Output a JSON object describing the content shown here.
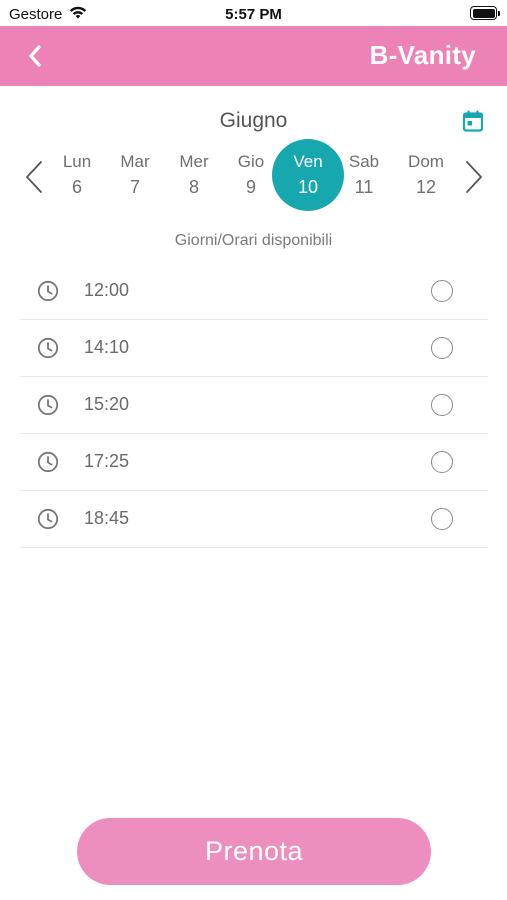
{
  "status_bar": {
    "carrier": "Gestore",
    "time": "5:57 PM"
  },
  "header": {
    "title": "B-Vanity",
    "back_icon": "chevron-left-icon",
    "background_color": "#ec82b6"
  },
  "calendar": {
    "month": "Giugno",
    "calendar_icon": "calendar-icon",
    "days": [
      {
        "name": "Lun",
        "number": "6",
        "selected": false
      },
      {
        "name": "Mar",
        "number": "7",
        "selected": false
      },
      {
        "name": "Mer",
        "number": "8",
        "selected": false
      },
      {
        "name": "Gio",
        "number": "9",
        "selected": false
      },
      {
        "name": "Ven",
        "number": "10",
        "selected": true
      },
      {
        "name": "Sab",
        "number": "11",
        "selected": false
      },
      {
        "name": "Dom",
        "number": "12",
        "selected": false
      }
    ],
    "selected_color": "#17a7af"
  },
  "availability": {
    "label": "Giorni/Orari disponibili",
    "slots": [
      {
        "time": "12:00",
        "selected": false
      },
      {
        "time": "14:10",
        "selected": false
      },
      {
        "time": "15:20",
        "selected": false
      },
      {
        "time": "17:25",
        "selected": false
      },
      {
        "time": "18:45",
        "selected": false
      }
    ]
  },
  "footer": {
    "book_label": "Prenota",
    "button_color": "#ec8fbf"
  }
}
